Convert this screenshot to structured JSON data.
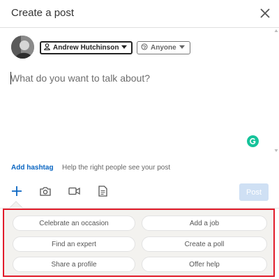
{
  "header": {
    "title": "Create a post"
  },
  "author": {
    "name": "Andrew Hutchinson"
  },
  "audience": {
    "label": "Anyone"
  },
  "composer": {
    "placeholder": "What do you want to talk about?"
  },
  "hashtag": {
    "link": "Add hashtag",
    "help": "Help the right people see your post"
  },
  "post_button": {
    "label": "Post",
    "enabled": false
  },
  "toolbar": {
    "icons": [
      "plus-icon",
      "camera-icon",
      "video-icon",
      "document-icon"
    ]
  },
  "suggestions": [
    {
      "label": "Celebrate an occasion"
    },
    {
      "label": "Add a job"
    },
    {
      "label": "Find an expert"
    },
    {
      "label": "Create a poll"
    },
    {
      "label": "Share a profile"
    },
    {
      "label": "Offer help"
    }
  ],
  "colors": {
    "accent": "#0a66c2",
    "highlight": "#e21b2a",
    "grammarly": "#15c39a",
    "post_disabled": "#cfe0f4"
  }
}
